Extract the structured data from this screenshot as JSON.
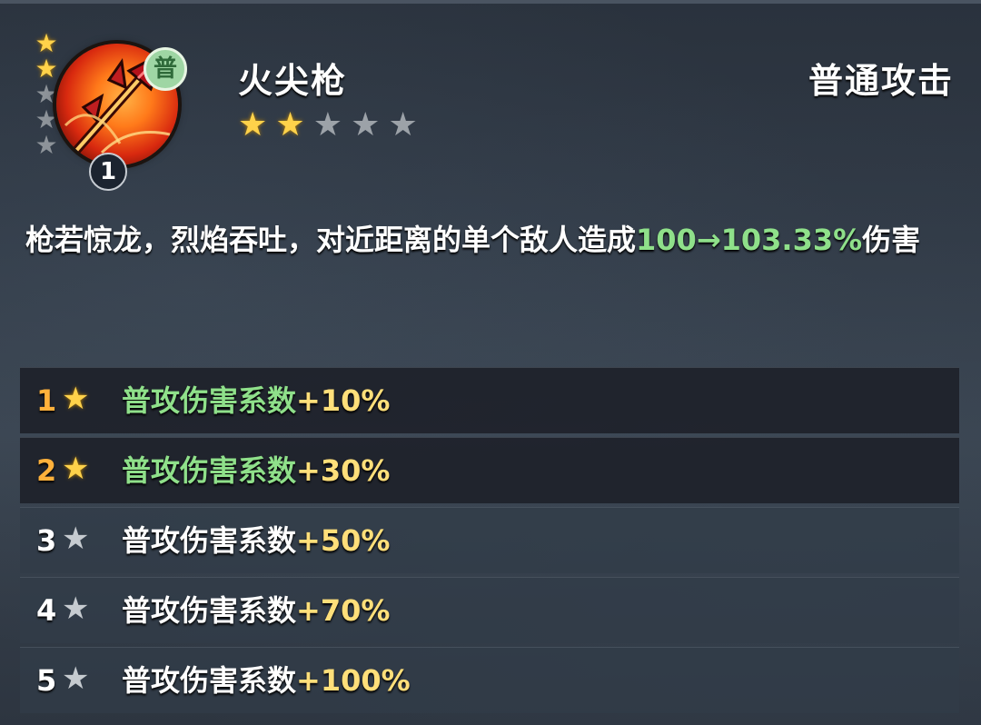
{
  "skill": {
    "name": "火尖枪",
    "type_label": "普通攻击",
    "tag": "普",
    "level": "1",
    "icon": "fire-spear-icon",
    "grade_stars": {
      "filled": 2,
      "total": 5
    },
    "star_rating": {
      "filled": 2,
      "total": 5
    }
  },
  "description": {
    "prefix": "枪若惊龙，烈焰吞吐，对近距离的单个敌人造成",
    "highlight": "100→103.33%",
    "suffix": "伤害"
  },
  "upgrades": [
    {
      "level": "1",
      "label": "普攻伤害系数",
      "value": "+10%",
      "unlocked": true
    },
    {
      "level": "2",
      "label": "普攻伤害系数",
      "value": "+30%",
      "unlocked": true
    },
    {
      "level": "3",
      "label": "普攻伤害系数",
      "value": "+50%",
      "unlocked": false
    },
    {
      "level": "4",
      "label": "普攻伤害系数",
      "value": "+70%",
      "unlocked": false
    },
    {
      "level": "5",
      "label": "普攻伤害系数",
      "value": "+100%",
      "unlocked": false
    }
  ],
  "colors": {
    "star_on": "#ffd24a",
    "star_off": "#9ca2a8",
    "highlight_green": "#8fe08a",
    "value_gold": "#ffdf7a",
    "level_orange": "#ffb13b"
  }
}
